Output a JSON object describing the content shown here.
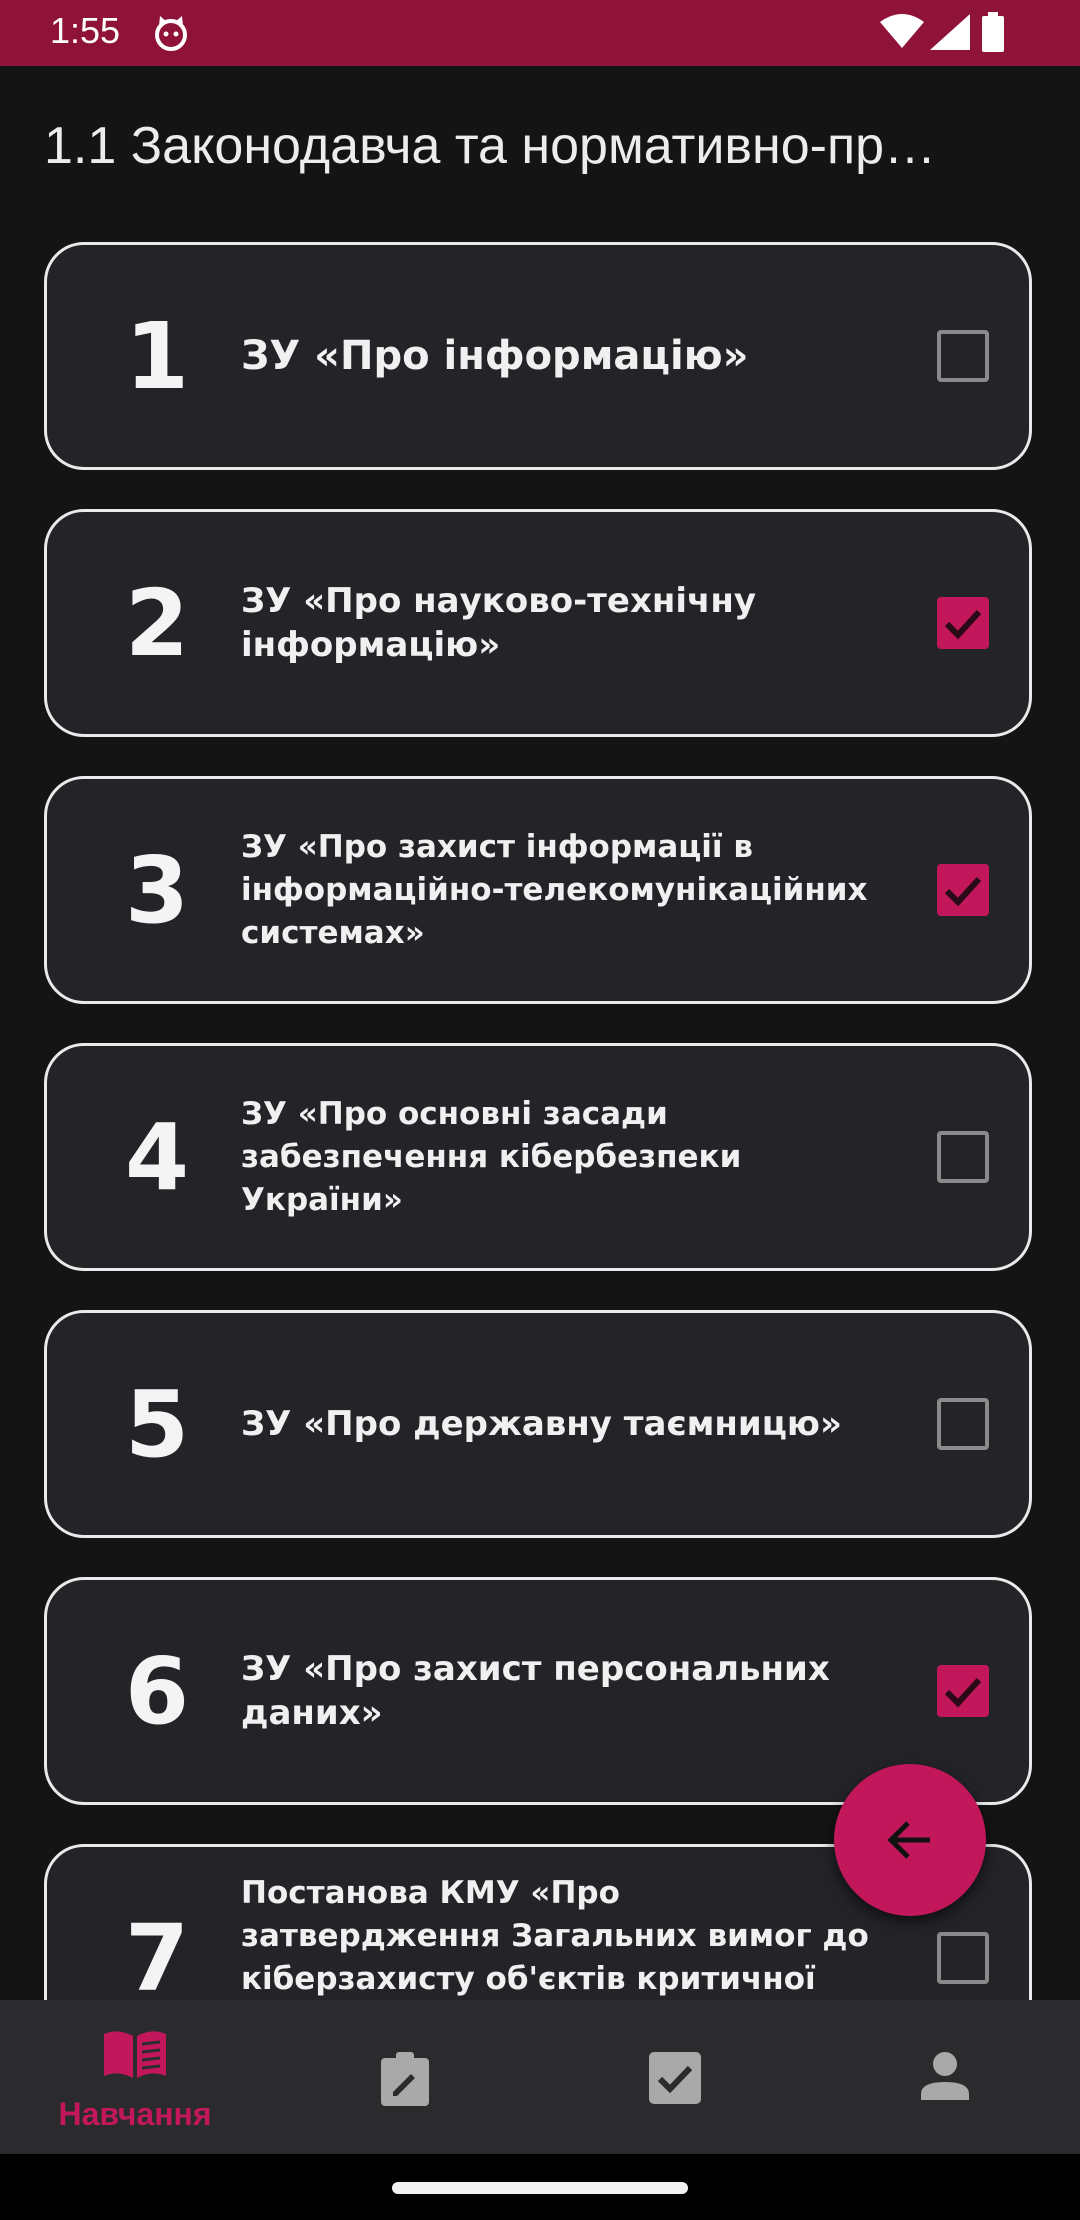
{
  "status_bar": {
    "time": "1:55",
    "icons": [
      "cat-icon",
      "wifi-icon",
      "signal-icon",
      "battery-icon"
    ]
  },
  "header": {
    "title": "1.1 Законодавча та нормативно-пр…"
  },
  "lessons": [
    {
      "number": "1",
      "title": "ЗУ «Про інформацію»",
      "checked": false
    },
    {
      "number": "2",
      "title": "ЗУ «Про науково-технічну інформацію»",
      "checked": true
    },
    {
      "number": "3",
      "title": "ЗУ «Про захист інформації в інформаційно-телекомунікаційних системах»",
      "checked": true
    },
    {
      "number": "4",
      "title": "ЗУ «Про основні засади забезпечення кібербезпеки України»",
      "checked": false
    },
    {
      "number": "5",
      "title": "ЗУ «Про державну таємницю»",
      "checked": false
    },
    {
      "number": "6",
      "title": "ЗУ «Про захист персональних даних»",
      "checked": true
    },
    {
      "number": "7",
      "title": "Постанова КМУ «Про затвердження Загальних вимог до кіберзахисту об'єктів критичної інфраструктури»",
      "checked": false
    }
  ],
  "fab": {
    "icon": "arrow-back-icon"
  },
  "bottom_nav": {
    "items": [
      {
        "icon": "book-icon",
        "label": "Навчання",
        "active": true
      },
      {
        "icon": "clipboard-edit-icon",
        "label": "",
        "active": false
      },
      {
        "icon": "checkbox-icon",
        "label": "",
        "active": false
      },
      {
        "icon": "person-icon",
        "label": "",
        "active": false
      }
    ]
  },
  "colors": {
    "accent": "#c2185b",
    "status_bar": "#8f1339",
    "background": "#141414",
    "card": "#232328",
    "nav_background": "#2b2b2d"
  }
}
